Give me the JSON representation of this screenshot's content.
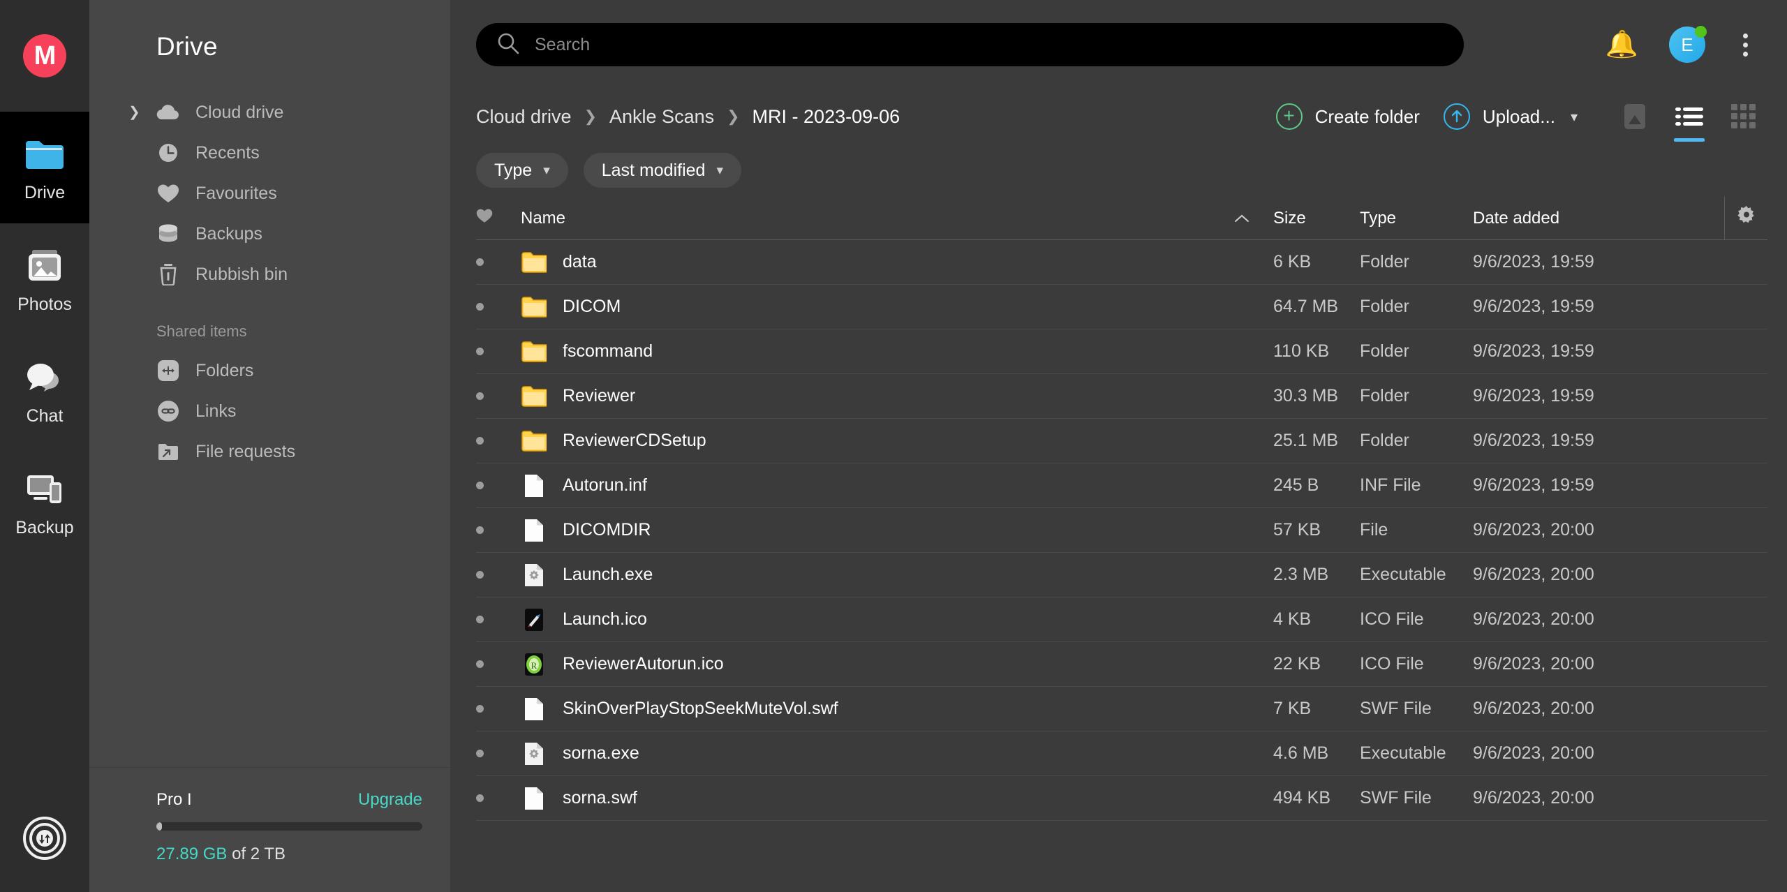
{
  "brand": {
    "logo_letter": "M",
    "logo_color": "#f7415b"
  },
  "rail": {
    "items": [
      {
        "label": "Drive",
        "icon": "folder-icon",
        "active": true
      },
      {
        "label": "Photos",
        "icon": "photos-icon",
        "active": false
      },
      {
        "label": "Chat",
        "icon": "chat-icon",
        "active": false
      },
      {
        "label": "Backup",
        "icon": "backup-devices-icon",
        "active": false
      }
    ],
    "bottom_icon": "transfers-icon"
  },
  "nav": {
    "title": "Drive",
    "items": [
      {
        "label": "Cloud drive",
        "icon": "cloud-icon",
        "expandable": true
      },
      {
        "label": "Recents",
        "icon": "clock-icon",
        "expandable": false
      },
      {
        "label": "Favourites",
        "icon": "heart-icon",
        "expandable": false
      },
      {
        "label": "Backups",
        "icon": "database-icon",
        "expandable": false
      },
      {
        "label": "Rubbish bin",
        "icon": "trash-icon",
        "expandable": false
      }
    ],
    "section_label": "Shared items",
    "shared_items": [
      {
        "label": "Folders",
        "icon": "shared-folders-icon"
      },
      {
        "label": "Links",
        "icon": "link-icon"
      },
      {
        "label": "File requests",
        "icon": "file-request-icon"
      }
    ],
    "plan": {
      "name": "Pro I",
      "upgrade_label": "Upgrade",
      "used": "27.89 GB",
      "of_label": " of 2 TB",
      "progress_percent": 1.4,
      "accent_color": "#45d9c8"
    }
  },
  "search": {
    "placeholder": "Search",
    "value": "",
    "icon": "search-icon"
  },
  "topbar": {
    "notifications_icon": "bell-icon",
    "avatar_letter": "E",
    "presence": "online",
    "menu_icon": "kebab-menu-icon"
  },
  "breadcrumb": [
    {
      "label": "Cloud drive"
    },
    {
      "label": "Ankle Scans"
    },
    {
      "label": "MRI - 2023-09-06"
    }
  ],
  "actions": {
    "create_folder_label": "Create folder",
    "create_folder_icon": "plus-circle-icon",
    "upload_label": "Upload...",
    "upload_icon": "upload-circle-icon",
    "upload_caret_icon": "chevron-down-icon",
    "view_media_icon": "media-view-icon",
    "view_list_icon": "list-view-icon",
    "view_grid_icon": "grid-view-icon",
    "active_view": "list"
  },
  "filters": [
    {
      "label": "Type",
      "icon": "chevron-down-icon"
    },
    {
      "label": "Last modified",
      "icon": "chevron-down-icon"
    }
  ],
  "table": {
    "columns": {
      "fav": "",
      "fav_icon": "heart-icon",
      "name": "Name",
      "sort_icon": "chevron-up-icon",
      "size": "Size",
      "type": "Type",
      "date": "Date added",
      "settings_icon": "gear-icon"
    },
    "rows": [
      {
        "name": "data",
        "size": "6 KB",
        "type": "Folder",
        "date": "9/6/2023, 19:59",
        "icon": "folder-icon"
      },
      {
        "name": "DICOM",
        "size": "64.7 MB",
        "type": "Folder",
        "date": "9/6/2023, 19:59",
        "icon": "folder-icon"
      },
      {
        "name": "fscommand",
        "size": "110 KB",
        "type": "Folder",
        "date": "9/6/2023, 19:59",
        "icon": "folder-icon"
      },
      {
        "name": "Reviewer",
        "size": "30.3 MB",
        "type": "Folder",
        "date": "9/6/2023, 19:59",
        "icon": "folder-icon"
      },
      {
        "name": "ReviewerCDSetup",
        "size": "25.1 MB",
        "type": "Folder",
        "date": "9/6/2023, 19:59",
        "icon": "folder-icon"
      },
      {
        "name": "Autorun.inf",
        "size": "245 B",
        "type": "INF File",
        "date": "9/6/2023, 19:59",
        "icon": "generic-file-icon"
      },
      {
        "name": "DICOMDIR",
        "size": "57 KB",
        "type": "File",
        "date": "9/6/2023, 20:00",
        "icon": "generic-file-icon"
      },
      {
        "name": "Launch.exe",
        "size": "2.3 MB",
        "type": "Executable",
        "date": "9/6/2023, 20:00",
        "icon": "executable-file-icon"
      },
      {
        "name": "Launch.ico",
        "size": "4 KB",
        "type": "ICO File",
        "date": "9/6/2023, 20:00",
        "icon": "ico-launch-icon"
      },
      {
        "name": "ReviewerAutorun.ico",
        "size": "22 KB",
        "type": "ICO File",
        "date": "9/6/2023, 20:00",
        "icon": "ico-reviewer-icon"
      },
      {
        "name": "SkinOverPlayStopSeekMuteVol.swf",
        "size": "7 KB",
        "type": "SWF File",
        "date": "9/6/2023, 20:00",
        "icon": "generic-file-icon"
      },
      {
        "name": "sorna.exe",
        "size": "4.6 MB",
        "type": "Executable",
        "date": "9/6/2023, 20:00",
        "icon": "executable-file-icon"
      },
      {
        "name": "sorna.swf",
        "size": "494 KB",
        "type": "SWF File",
        "date": "9/6/2023, 20:00",
        "icon": "generic-file-icon"
      }
    ]
  }
}
